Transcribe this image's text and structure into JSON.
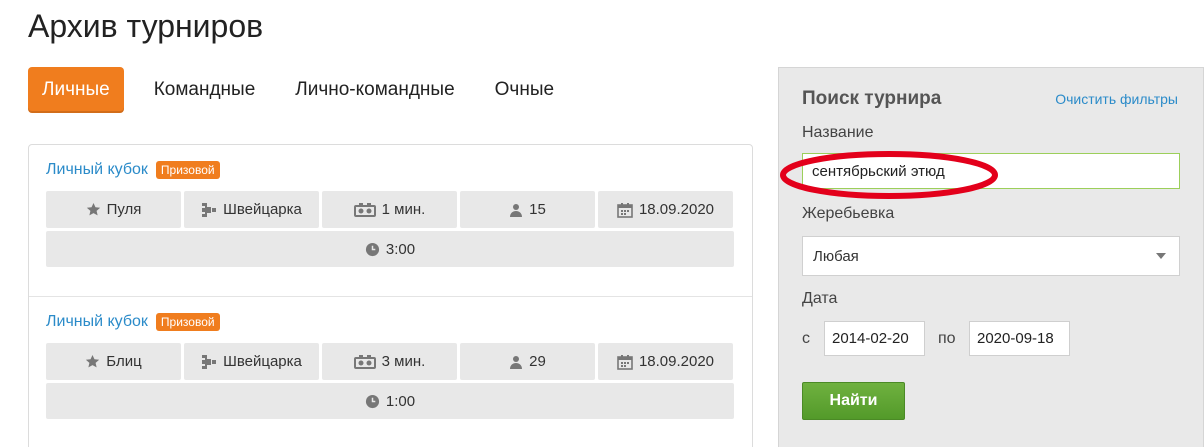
{
  "page": {
    "title": "Архив турниров"
  },
  "tabs": [
    {
      "label": "Личные",
      "active": true
    },
    {
      "label": "Командные",
      "active": false
    },
    {
      "label": "Лично-командные",
      "active": false
    },
    {
      "label": "Очные",
      "active": false
    }
  ],
  "tournaments": [
    {
      "title": "Личный кубок",
      "badge": "Призовой",
      "type": "Пуля",
      "system": "Швейцарка",
      "time_control": "1 мин.",
      "players": "15",
      "date": "18.09.2020",
      "duration": "3:00"
    },
    {
      "title": "Личный кубок",
      "badge": "Призовой",
      "type": "Блиц",
      "system": "Швейцарка",
      "time_control": "3 мин.",
      "players": "29",
      "date": "18.09.2020",
      "duration": "1:00"
    }
  ],
  "search": {
    "title": "Поиск турнира",
    "clear_label": "Очистить фильтры",
    "name_label": "Название",
    "name_value": "сентябрьский этюд",
    "draw_label": "Жеребьевка",
    "draw_value": "Любая",
    "date_label": "Дата",
    "from_prefix": "с",
    "from_value": "2014-02-20",
    "to_prefix": "по",
    "to_value": "2020-09-18",
    "find_label": "Найти"
  },
  "icons": {
    "type": "star-icon",
    "system": "bracket-icon",
    "time_control": "clock-pair-icon",
    "players": "person-icon",
    "date": "calendar-icon",
    "duration": "clock-icon"
  },
  "colors": {
    "accent": "#f07d1e",
    "link": "#2b8bc9",
    "find_button": "#5ea432",
    "annotation": "#e3001b"
  }
}
